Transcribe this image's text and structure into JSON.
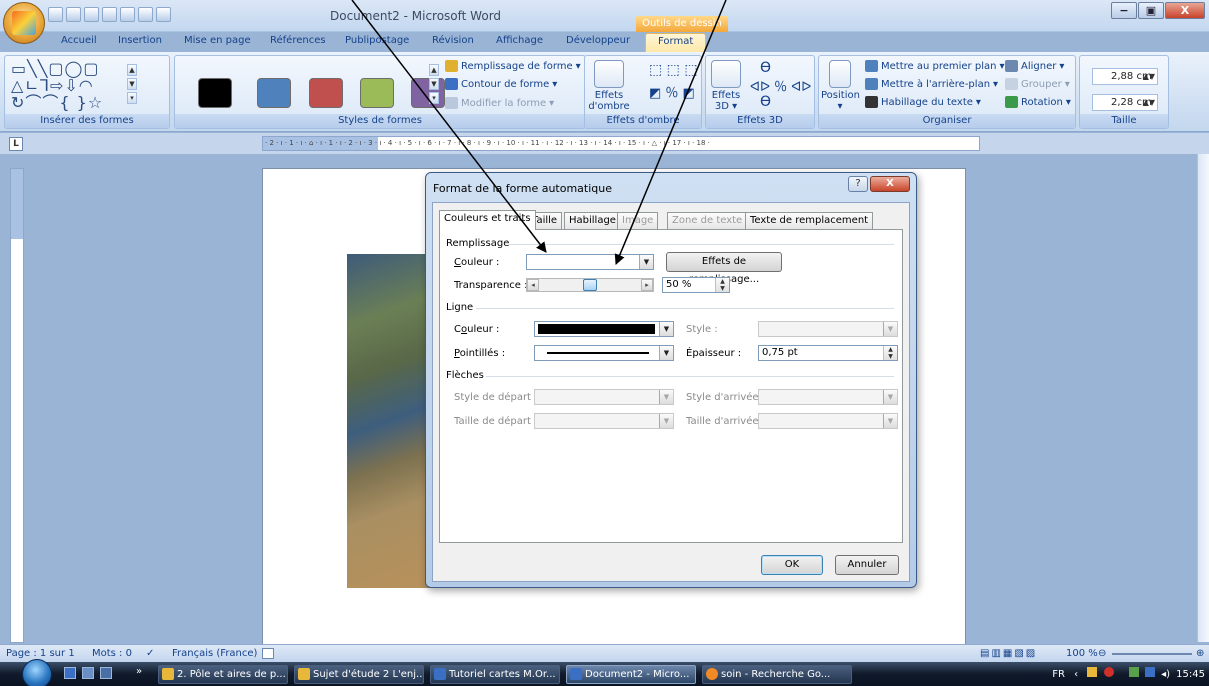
{
  "window": {
    "title": "Document2 - Microsoft Word",
    "contextual_tab_title": "Outils de dessin",
    "controls": [
      "−",
      "▣",
      "X"
    ]
  },
  "tabs": [
    "Accueil",
    "Insertion",
    "Mise en page",
    "Références",
    "Publipostage",
    "Révision",
    "Affichage",
    "Développeur",
    "Format"
  ],
  "active_tab": "Format",
  "ribbon": {
    "groups": {
      "shapes": "Insérer des formes",
      "styles": "Styles de formes",
      "shadow": "Effets d'ombre",
      "effects3d": "Effets 3D",
      "arrange": "Organiser",
      "size": "Taille"
    },
    "style_swatches": [
      "#000000",
      "#4f81bd",
      "#c0504d",
      "#9bbb59",
      "#8064a2"
    ],
    "shape_style_commands": {
      "fill": "Remplissage de forme",
      "outline": "Contour de forme",
      "change": "Modifier la forme"
    },
    "shadow_button": {
      "line1": "Effets",
      "line2": "d'ombre"
    },
    "effects3d_button": {
      "line1": "Effets",
      "line2": "3D"
    },
    "position_button": "Position",
    "arrange_commands": {
      "front": "Mettre au premier plan",
      "back": "Mettre à l'arrière-plan",
      "wrap": "Habillage du texte",
      "align": "Aligner",
      "group": "Grouper",
      "rotate": "Rotation"
    },
    "size": {
      "height": "2,88 cm",
      "width": "2,28 cm"
    }
  },
  "ruler": {
    "text": "· 2 · ı · 1 · ı · ⌂ · ı · 1 · ı · 2 · ı · 3 · ı · 4 · ı · 5 · ı · 6 · ı · 7 · ı · 8 · ı · 9 · ı · 10 · ı · 11 · ı · 12 · ı · 13 · ı · 14 · ı · 15 · ı · △ · ı · 17 · ı · 18 ·",
    "tab_selector": "L"
  },
  "dialog": {
    "title": "Format de la forme automatique",
    "help": "?",
    "close": "X",
    "tabs": [
      {
        "label": "Couleurs et traits",
        "state": "active"
      },
      {
        "label": "Taille",
        "state": "normal"
      },
      {
        "label": "Habillage",
        "state": "normal"
      },
      {
        "label": "Image",
        "state": "disabled"
      },
      {
        "label": "Zone de texte",
        "state": "disabled"
      },
      {
        "label": "Texte de remplacement",
        "state": "normal"
      }
    ],
    "fill": {
      "section": "Remplissage",
      "color_label": "Couleur :",
      "color_value": "",
      "effects_button": "Effets de remplissage...",
      "transparency_label": "Transparence :",
      "transparency_value": "50 %",
      "transparency_level": 0.5
    },
    "line": {
      "section": "Ligne",
      "color_label": "Couleur :",
      "color_value": "#000000",
      "style_label": "Style :",
      "dashes_label": "Pointillés :",
      "weight_label": "Épaisseur :",
      "weight_value": "0,75 pt"
    },
    "arrows": {
      "section": "Flèches",
      "begin_style": "Style de départ :",
      "end_style": "Style d'arrivée :",
      "begin_size": "Taille de départ :",
      "end_size": "Taille d'arrivée :"
    },
    "ok": "OK",
    "cancel": "Annuler"
  },
  "statusbar": {
    "page": "Page : 1 sur 1",
    "words": "Mots : 0",
    "language": "Français (France)",
    "zoom": "100 %"
  },
  "taskbar": {
    "items": [
      {
        "label": "2. Pôle et aires de p...",
        "icon_color": "#e8b83a",
        "active": false
      },
      {
        "label": "Sujet d'étude 2 L'enj...",
        "icon_color": "#e8b83a",
        "active": false
      },
      {
        "label": "Tutoriel cartes M.Or...",
        "icon_color": "#3a6fc4",
        "active": false
      },
      {
        "label": "Document2 - Micro...",
        "icon_color": "#3a6fc4",
        "active": true
      },
      {
        "label": "soin - Recherche Go...",
        "icon_color": "#f08a24",
        "active": false
      }
    ],
    "lang": "FR",
    "time": "15:45",
    "overflow": "»"
  }
}
